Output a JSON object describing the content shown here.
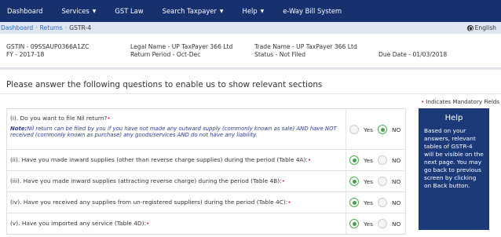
{
  "nav": {
    "items": [
      {
        "label": "Dashboard",
        "caret": false
      },
      {
        "label": "Services",
        "caret": true
      },
      {
        "label": "GST Law",
        "caret": false
      },
      {
        "label": "Search Taxpayer",
        "caret": true
      },
      {
        "label": "Help",
        "caret": true
      },
      {
        "label": "e-Way Bill System",
        "caret": false
      }
    ],
    "caret_glyph": "▼"
  },
  "breadcrumb": {
    "items": [
      "Dashboard",
      "Returns"
    ],
    "current": "GSTR-4",
    "separator": "›"
  },
  "language": {
    "label": "English"
  },
  "info": {
    "gstin": "GSTIN - 09SSAUP0366A1ZC",
    "fy": "FY - 2017-18",
    "legal_name": "Legal Name - UP TaxPayer 366 Ltd",
    "return_period": "Return Period - Oct-Dec",
    "trade_name": "Trade Name - UP TaxPayer 366 Ltd",
    "status": "Status - Not Filed",
    "due_date": "Due Date - 01/03/2018"
  },
  "main": {
    "heading": "Please answer the following questions to enable us to show relevant sections",
    "mandatory_note": "Indicates Mandatory Fields",
    "questions": [
      {
        "text": "(i). Do you want to file Nil return?",
        "note_label": "Note:",
        "note": "Nil return can be filed by you if you have not made any outward supply (commonly known as sale) AND have NOT received (commonly known as purchase) any goods/services AND do not have any liability.",
        "selected": "NO"
      },
      {
        "text": "(ii). Have you made inward supplies (other than reverse charge supplies) during the period (Table 4A):",
        "selected": "Yes"
      },
      {
        "text": "(iii). Have you made inward supplies (attracting reverse charge) during the period (Table 4B):",
        "selected": "Yes"
      },
      {
        "text": "(iv). Have you received any supplies from un-registered suppliers) during the period (Table 4C):",
        "selected": "Yes"
      },
      {
        "text": "(v). Have you imported any service (Table 4D):",
        "selected": "Yes"
      }
    ],
    "yes_label": "Yes",
    "no_label": "NO",
    "required_mark": "•"
  },
  "help": {
    "title": "Help",
    "body": "Based on your answers, relevant tables of GSTR-4 will be visible on the next page. You may go back to previous screen by clicking on Back button."
  },
  "colors": {
    "nav_bg": "#17306e",
    "help_bg": "#1c3a7a",
    "radio_selected": "#43a047",
    "required": "#d9232d",
    "note_text": "#2b3a8f",
    "link": "#2c66c4"
  }
}
